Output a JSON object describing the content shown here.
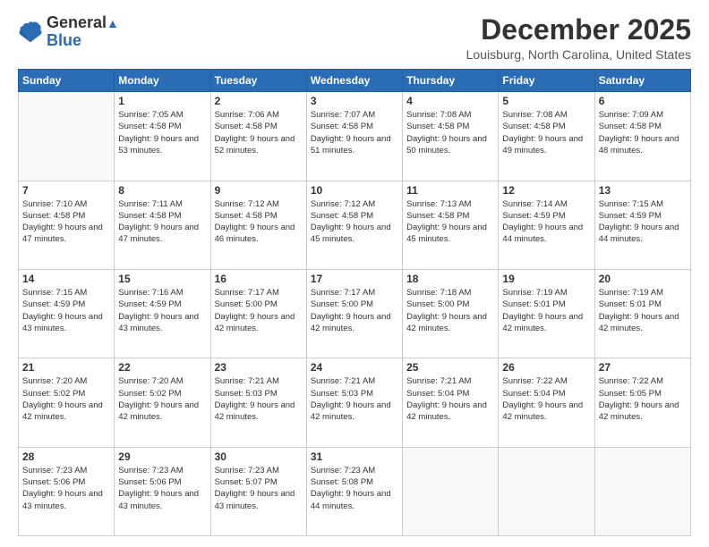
{
  "logo": {
    "line1": "General",
    "line2": "Blue"
  },
  "title": "December 2025",
  "location": "Louisburg, North Carolina, United States",
  "days_header": [
    "Sunday",
    "Monday",
    "Tuesday",
    "Wednesday",
    "Thursday",
    "Friday",
    "Saturday"
  ],
  "weeks": [
    [
      {
        "day": "",
        "sunrise": "",
        "sunset": "",
        "daylight": ""
      },
      {
        "day": "1",
        "sunrise": "Sunrise: 7:05 AM",
        "sunset": "Sunset: 4:58 PM",
        "daylight": "Daylight: 9 hours and 53 minutes."
      },
      {
        "day": "2",
        "sunrise": "Sunrise: 7:06 AM",
        "sunset": "Sunset: 4:58 PM",
        "daylight": "Daylight: 9 hours and 52 minutes."
      },
      {
        "day": "3",
        "sunrise": "Sunrise: 7:07 AM",
        "sunset": "Sunset: 4:58 PM",
        "daylight": "Daylight: 9 hours and 51 minutes."
      },
      {
        "day": "4",
        "sunrise": "Sunrise: 7:08 AM",
        "sunset": "Sunset: 4:58 PM",
        "daylight": "Daylight: 9 hours and 50 minutes."
      },
      {
        "day": "5",
        "sunrise": "Sunrise: 7:08 AM",
        "sunset": "Sunset: 4:58 PM",
        "daylight": "Daylight: 9 hours and 49 minutes."
      },
      {
        "day": "6",
        "sunrise": "Sunrise: 7:09 AM",
        "sunset": "Sunset: 4:58 PM",
        "daylight": "Daylight: 9 hours and 48 minutes."
      }
    ],
    [
      {
        "day": "7",
        "sunrise": "Sunrise: 7:10 AM",
        "sunset": "Sunset: 4:58 PM",
        "daylight": "Daylight: 9 hours and 47 minutes."
      },
      {
        "day": "8",
        "sunrise": "Sunrise: 7:11 AM",
        "sunset": "Sunset: 4:58 PM",
        "daylight": "Daylight: 9 hours and 47 minutes."
      },
      {
        "day": "9",
        "sunrise": "Sunrise: 7:12 AM",
        "sunset": "Sunset: 4:58 PM",
        "daylight": "Daylight: 9 hours and 46 minutes."
      },
      {
        "day": "10",
        "sunrise": "Sunrise: 7:12 AM",
        "sunset": "Sunset: 4:58 PM",
        "daylight": "Daylight: 9 hours and 45 minutes."
      },
      {
        "day": "11",
        "sunrise": "Sunrise: 7:13 AM",
        "sunset": "Sunset: 4:58 PM",
        "daylight": "Daylight: 9 hours and 45 minutes."
      },
      {
        "day": "12",
        "sunrise": "Sunrise: 7:14 AM",
        "sunset": "Sunset: 4:59 PM",
        "daylight": "Daylight: 9 hours and 44 minutes."
      },
      {
        "day": "13",
        "sunrise": "Sunrise: 7:15 AM",
        "sunset": "Sunset: 4:59 PM",
        "daylight": "Daylight: 9 hours and 44 minutes."
      }
    ],
    [
      {
        "day": "14",
        "sunrise": "Sunrise: 7:15 AM",
        "sunset": "Sunset: 4:59 PM",
        "daylight": "Daylight: 9 hours and 43 minutes."
      },
      {
        "day": "15",
        "sunrise": "Sunrise: 7:16 AM",
        "sunset": "Sunset: 4:59 PM",
        "daylight": "Daylight: 9 hours and 43 minutes."
      },
      {
        "day": "16",
        "sunrise": "Sunrise: 7:17 AM",
        "sunset": "Sunset: 5:00 PM",
        "daylight": "Daylight: 9 hours and 42 minutes."
      },
      {
        "day": "17",
        "sunrise": "Sunrise: 7:17 AM",
        "sunset": "Sunset: 5:00 PM",
        "daylight": "Daylight: 9 hours and 42 minutes."
      },
      {
        "day": "18",
        "sunrise": "Sunrise: 7:18 AM",
        "sunset": "Sunset: 5:00 PM",
        "daylight": "Daylight: 9 hours and 42 minutes."
      },
      {
        "day": "19",
        "sunrise": "Sunrise: 7:19 AM",
        "sunset": "Sunset: 5:01 PM",
        "daylight": "Daylight: 9 hours and 42 minutes."
      },
      {
        "day": "20",
        "sunrise": "Sunrise: 7:19 AM",
        "sunset": "Sunset: 5:01 PM",
        "daylight": "Daylight: 9 hours and 42 minutes."
      }
    ],
    [
      {
        "day": "21",
        "sunrise": "Sunrise: 7:20 AM",
        "sunset": "Sunset: 5:02 PM",
        "daylight": "Daylight: 9 hours and 42 minutes."
      },
      {
        "day": "22",
        "sunrise": "Sunrise: 7:20 AM",
        "sunset": "Sunset: 5:02 PM",
        "daylight": "Daylight: 9 hours and 42 minutes."
      },
      {
        "day": "23",
        "sunrise": "Sunrise: 7:21 AM",
        "sunset": "Sunset: 5:03 PM",
        "daylight": "Daylight: 9 hours and 42 minutes."
      },
      {
        "day": "24",
        "sunrise": "Sunrise: 7:21 AM",
        "sunset": "Sunset: 5:03 PM",
        "daylight": "Daylight: 9 hours and 42 minutes."
      },
      {
        "day": "25",
        "sunrise": "Sunrise: 7:21 AM",
        "sunset": "Sunset: 5:04 PM",
        "daylight": "Daylight: 9 hours and 42 minutes."
      },
      {
        "day": "26",
        "sunrise": "Sunrise: 7:22 AM",
        "sunset": "Sunset: 5:04 PM",
        "daylight": "Daylight: 9 hours and 42 minutes."
      },
      {
        "day": "27",
        "sunrise": "Sunrise: 7:22 AM",
        "sunset": "Sunset: 5:05 PM",
        "daylight": "Daylight: 9 hours and 42 minutes."
      }
    ],
    [
      {
        "day": "28",
        "sunrise": "Sunrise: 7:23 AM",
        "sunset": "Sunset: 5:06 PM",
        "daylight": "Daylight: 9 hours and 43 minutes."
      },
      {
        "day": "29",
        "sunrise": "Sunrise: 7:23 AM",
        "sunset": "Sunset: 5:06 PM",
        "daylight": "Daylight: 9 hours and 43 minutes."
      },
      {
        "day": "30",
        "sunrise": "Sunrise: 7:23 AM",
        "sunset": "Sunset: 5:07 PM",
        "daylight": "Daylight: 9 hours and 43 minutes."
      },
      {
        "day": "31",
        "sunrise": "Sunrise: 7:23 AM",
        "sunset": "Sunset: 5:08 PM",
        "daylight": "Daylight: 9 hours and 44 minutes."
      },
      {
        "day": "",
        "sunrise": "",
        "sunset": "",
        "daylight": ""
      },
      {
        "day": "",
        "sunrise": "",
        "sunset": "",
        "daylight": ""
      },
      {
        "day": "",
        "sunrise": "",
        "sunset": "",
        "daylight": ""
      }
    ]
  ]
}
